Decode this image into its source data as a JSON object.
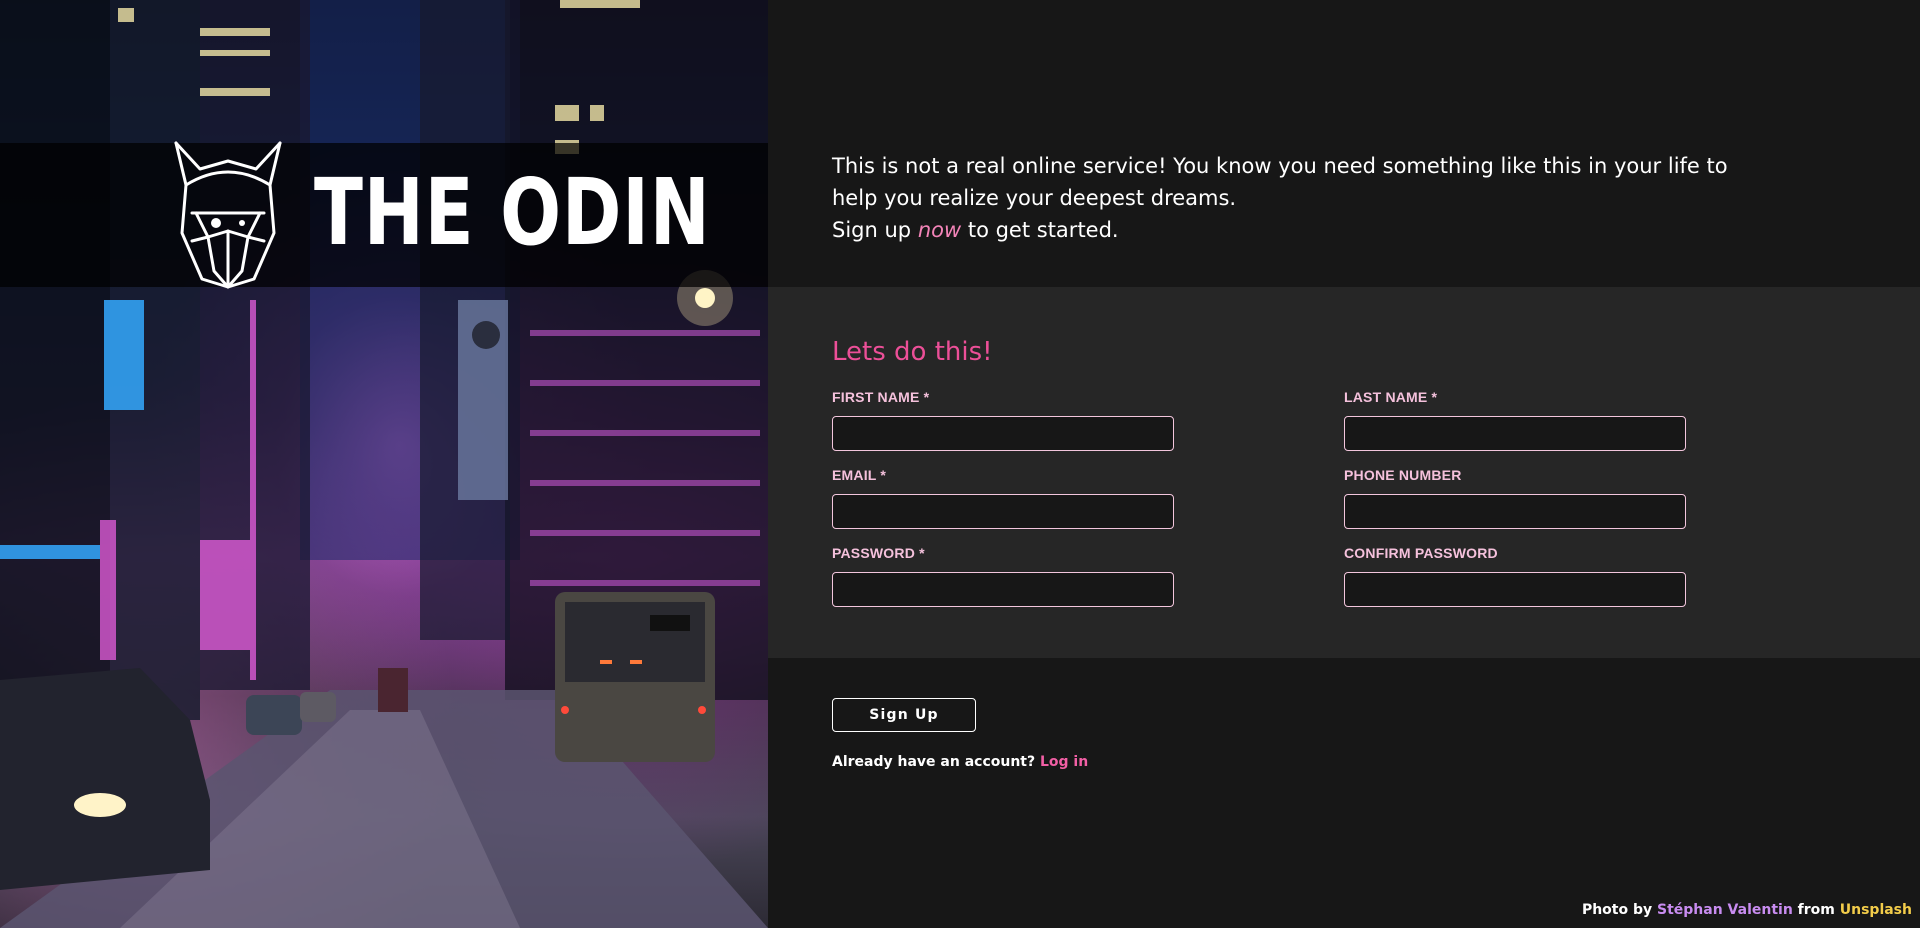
{
  "brand": {
    "name": "THE ODIN",
    "logo_icon": "odin-helmet-icon"
  },
  "photo_credit": {
    "prefix": "Photo by",
    "author": "Stéphan Valentin",
    "middle": "from",
    "site": "Unsplash"
  },
  "intro": {
    "line1": "This is not a real online service! You know you need something like this in your life to help you realize your deepest dreams.",
    "cta_before": "Sign up",
    "cta_emphasis": "now",
    "cta_after": "to get started."
  },
  "form": {
    "heading": "Lets do this!",
    "fields": {
      "first_name": {
        "label": "FIRST NAME *",
        "value": ""
      },
      "last_name": {
        "label": "LAST NAME *",
        "value": ""
      },
      "email": {
        "label": "EMAIL *",
        "value": ""
      },
      "phone": {
        "label": "PHONE NUMBER",
        "value": ""
      },
      "password": {
        "label": "PASSWORD *",
        "value": ""
      },
      "confirm_password": {
        "label": "CONFIRM PASSWORD",
        "value": ""
      }
    }
  },
  "actions": {
    "signup_label": "Sign Up",
    "login_prompt": "Already have an account?",
    "login_link": "Log in"
  },
  "colors": {
    "accent_pink": "#ec4f98",
    "label_pink": "#f5c1dc",
    "link_pink": "#f25fa5",
    "page_bg": "#171717",
    "panel_bg": "#262626"
  }
}
